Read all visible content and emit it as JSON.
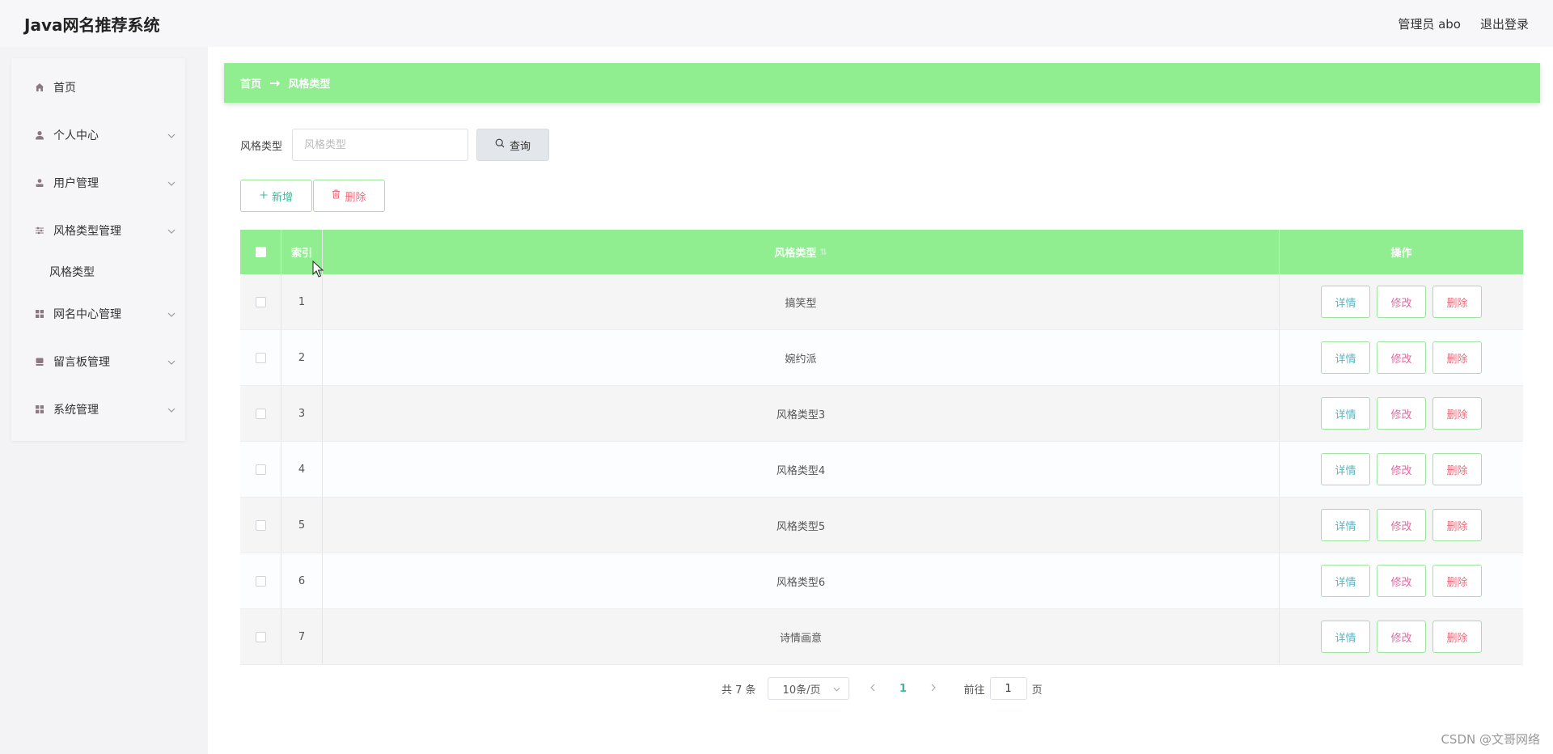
{
  "header": {
    "title": "Java网名推荐系统",
    "user": "管理员 abo",
    "logout": "退出登录"
  },
  "sidebar": {
    "items": [
      {
        "label": "首页",
        "icon": "home-icon",
        "has_children": false
      },
      {
        "label": "个人中心",
        "icon": "user-icon",
        "has_children": true
      },
      {
        "label": "用户管理",
        "icon": "user-manage-icon",
        "has_children": true
      },
      {
        "label": "风格类型管理",
        "icon": "sliders-icon",
        "has_children": true,
        "children": [
          {
            "label": "风格类型"
          }
        ]
      },
      {
        "label": "网名中心管理",
        "icon": "grid-icon",
        "has_children": true
      },
      {
        "label": "留言板管理",
        "icon": "message-board-icon",
        "has_children": true
      },
      {
        "label": "系统管理",
        "icon": "grid-icon",
        "has_children": true
      }
    ]
  },
  "breadcrumb": {
    "home": "首页",
    "arrow": "→",
    "current": "风格类型"
  },
  "search": {
    "label": "风格类型",
    "placeholder": "风格类型",
    "value": "",
    "button": "查询"
  },
  "actions": {
    "add": "新增",
    "delete": "删除"
  },
  "table": {
    "columns": {
      "index": "索引",
      "type": "风格类型",
      "ops": "操作"
    },
    "op_labels": {
      "detail": "详情",
      "edit": "修改",
      "delete": "删除"
    },
    "rows": [
      {
        "index": "1",
        "type": "搞笑型"
      },
      {
        "index": "2",
        "type": "婉约派"
      },
      {
        "index": "3",
        "type": "风格类型3"
      },
      {
        "index": "4",
        "type": "风格类型4"
      },
      {
        "index": "5",
        "type": "风格类型5"
      },
      {
        "index": "6",
        "type": "风格类型6"
      },
      {
        "index": "7",
        "type": "诗情画意"
      }
    ]
  },
  "pagination": {
    "total": "共 7 条",
    "page_size": "10条/页",
    "current_page": "1",
    "goto_label": "前往",
    "goto_value": "1",
    "goto_suffix": "页"
  },
  "watermark": "CSDN @文哥网络",
  "colors": {
    "accent_green": "#90ee90",
    "link_teal": "#3db89a",
    "danger": "#e96b7b"
  }
}
